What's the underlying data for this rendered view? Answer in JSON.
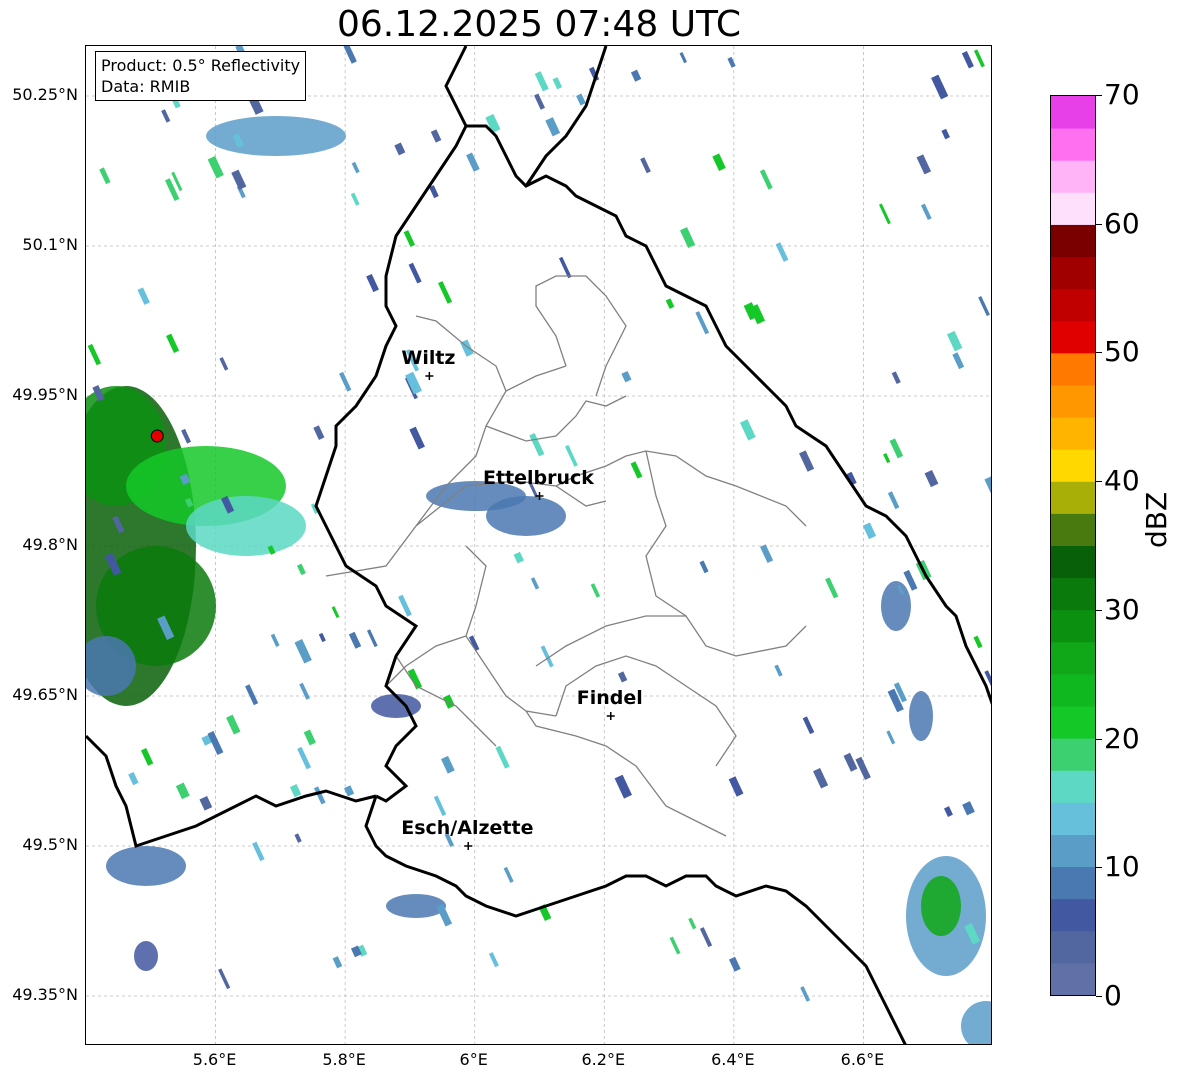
{
  "title": "06.12.2025 07:48 UTC",
  "info_box": {
    "product": "Product: 0.5° Reflectivity",
    "data_source": "Data: RMIB"
  },
  "map": {
    "lon_range": [
      5.4,
      6.8
    ],
    "lat_range": [
      49.3,
      50.3
    ],
    "lat_ticks": [
      "50.25°N",
      "50.1°N",
      "49.95°N",
      "49.8°N",
      "49.65°N",
      "49.5°N",
      "49.35°N"
    ],
    "lon_ticks": [
      "5.6°E",
      "5.8°E",
      "6°E",
      "6.2°E",
      "6.4°E",
      "6.6°E"
    ],
    "gridlines": true,
    "radar_site": {
      "lon": 5.51,
      "lat": 49.91,
      "color": "#e00000"
    },
    "cities": [
      {
        "name": "Wiltz",
        "lon": 5.93,
        "lat": 49.97
      },
      {
        "name": "Ettelbruck",
        "lon": 6.1,
        "lat": 49.85
      },
      {
        "name": "Findel",
        "lon": 6.21,
        "lat": 49.63
      },
      {
        "name": "Esch/Alzette",
        "lon": 5.99,
        "lat": 49.5
      }
    ]
  },
  "colorbar": {
    "label": "dBZ",
    "tick_labels": [
      "0",
      "10",
      "20",
      "30",
      "40",
      "50",
      "60",
      "70"
    ],
    "min": 0,
    "max": 70,
    "colors": [
      "#6270a8",
      "#52669f",
      "#4258a0",
      "#4a78b0",
      "#5a9ec8",
      "#66c0dc",
      "#5cd8c4",
      "#3cd070",
      "#14c828",
      "#10b820",
      "#10a818",
      "#0c9010",
      "#0a7a0c",
      "#086008",
      "#487a10",
      "#a8b008",
      "#ffd800",
      "#ffb400",
      "#ff9800",
      "#ff7800",
      "#e00000",
      "#c00000",
      "#a00000",
      "#7a0000",
      "#ffe0fc",
      "#ffb4f8",
      "#ff70f0",
      "#e840e8"
    ]
  }
}
